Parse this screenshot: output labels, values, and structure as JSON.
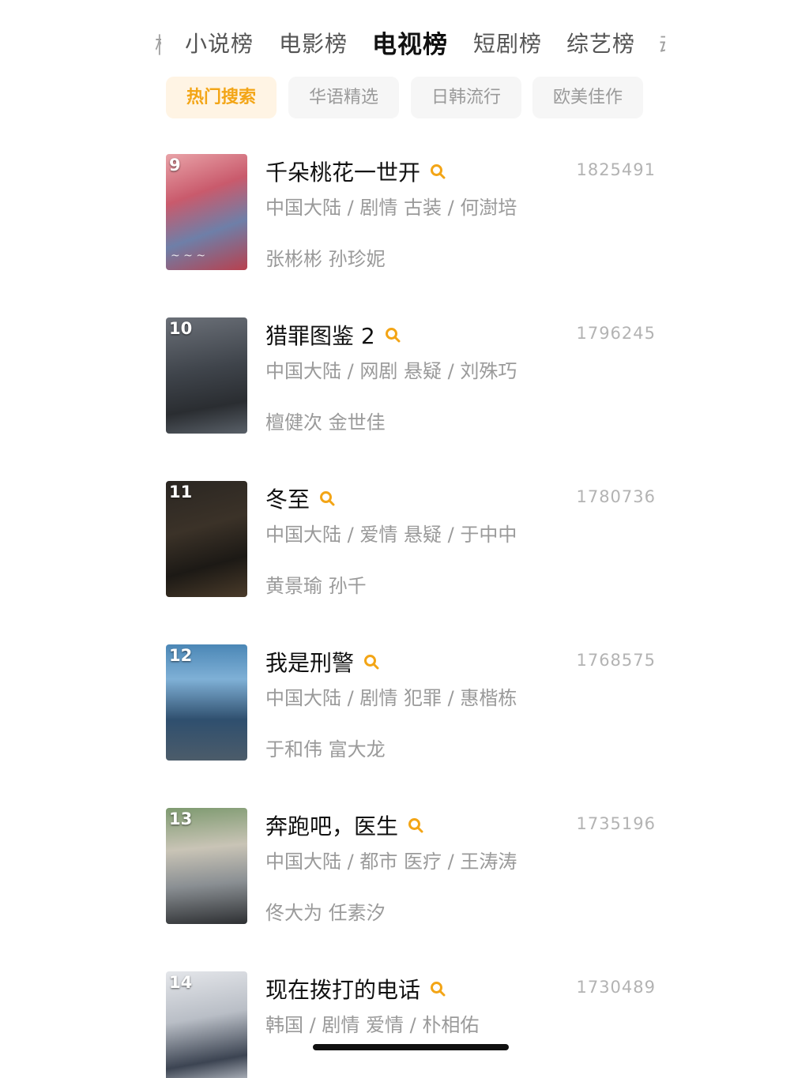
{
  "top_tabs": [
    {
      "label": "小说榜"
    },
    {
      "label": "电影榜"
    },
    {
      "label": "电视榜"
    },
    {
      "label": "短剧榜"
    },
    {
      "label": "综艺榜"
    }
  ],
  "active_tab": "电视榜",
  "filters": [
    {
      "label": "热门搜索"
    },
    {
      "label": "华语精选"
    },
    {
      "label": "日韩流行"
    },
    {
      "label": "欧美佳作"
    }
  ],
  "active_filter": "热门搜索",
  "colors": {
    "accent": "#f3a516",
    "chip_active_bg": "#fff4e4"
  },
  "items": [
    {
      "rank": "9",
      "title": "千朵桃花一世开",
      "count": "1825491",
      "meta": "中国大陆 / 剧情 古装 / 何澍培",
      "cast": "张彬彬 孙珍妮",
      "icon": "search-icon"
    },
    {
      "rank": "10",
      "title": "猎罪图鉴 2",
      "count": "1796245",
      "meta": "中国大陆 / 网剧 悬疑 / 刘殊巧",
      "cast": "檀健次 金世佳",
      "icon": "search-icon"
    },
    {
      "rank": "11",
      "title": "冬至",
      "count": "1780736",
      "meta": "中国大陆 / 爱情 悬疑 / 于中中",
      "cast": "黄景瑜 孙千",
      "icon": "search-icon"
    },
    {
      "rank": "12",
      "title": "我是刑警",
      "count": "1768575",
      "meta": "中国大陆 / 剧情 犯罪 / 惠楷栋",
      "cast": "于和伟 富大龙",
      "icon": "search-icon"
    },
    {
      "rank": "13",
      "title": "奔跑吧，医生",
      "count": "1735196",
      "meta": "中国大陆 / 都市 医疗 / 王涛涛",
      "cast": "佟大为 任素汐",
      "icon": "search-icon"
    },
    {
      "rank": "14",
      "title": "现在拨打的电话",
      "count": "1730489",
      "meta": "韩国 / 剧情 爱情 / 朴相佑",
      "cast": "",
      "icon": "search-icon"
    }
  ]
}
